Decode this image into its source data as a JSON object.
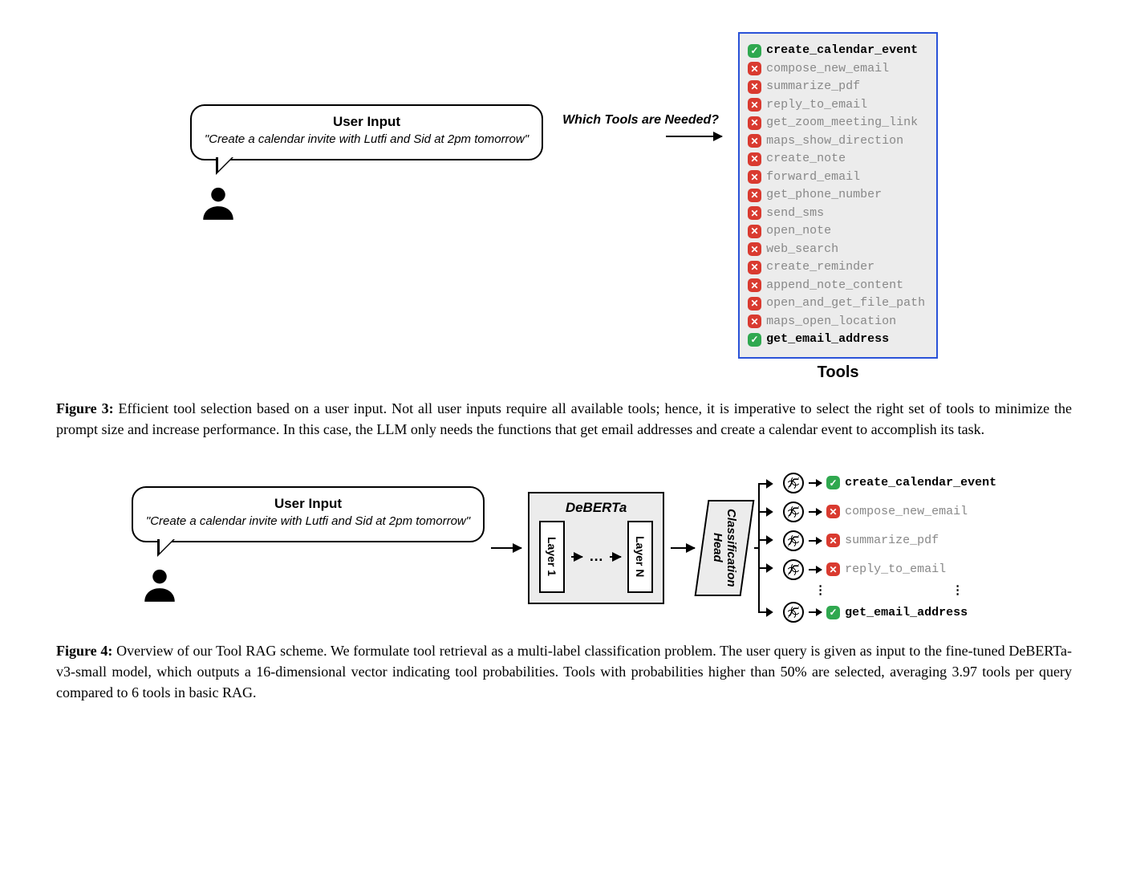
{
  "fig3": {
    "user_input_title": "User Input",
    "user_quote": "\"Create a calendar invite with Lutfi and Sid at 2pm tomorrow\"",
    "question": "Which Tools are Needed?",
    "tools_label": "Tools",
    "tools": [
      {
        "name": "create_calendar_event",
        "selected": true
      },
      {
        "name": "compose_new_email",
        "selected": false
      },
      {
        "name": "summarize_pdf",
        "selected": false
      },
      {
        "name": "reply_to_email",
        "selected": false
      },
      {
        "name": "get_zoom_meeting_link",
        "selected": false
      },
      {
        "name": "maps_show_direction",
        "selected": false
      },
      {
        "name": "create_note",
        "selected": false
      },
      {
        "name": "forward_email",
        "selected": false
      },
      {
        "name": "get_phone_number",
        "selected": false
      },
      {
        "name": "send_sms",
        "selected": false
      },
      {
        "name": "open_note",
        "selected": false
      },
      {
        "name": "web_search",
        "selected": false
      },
      {
        "name": "create_reminder",
        "selected": false
      },
      {
        "name": "append_note_content",
        "selected": false
      },
      {
        "name": "open_and_get_file_path",
        "selected": false
      },
      {
        "name": "maps_open_location",
        "selected": false
      },
      {
        "name": "get_email_address",
        "selected": true
      }
    ],
    "caption_label": "Figure 3:",
    "caption_text": "Efficient tool selection based on a user input. Not all user inputs require all available tools; hence, it is imperative to select the right set of tools to minimize the prompt size and increase performance. In this case, the LLM only needs the functions that get email addresses and create a calendar event to accomplish its task."
  },
  "fig4": {
    "user_input_title": "User Input",
    "user_quote": "\"Create a calendar invite with Lutfi and Sid at 2pm tomorrow\"",
    "model_title": "DeBERTa",
    "layer_first": "Layer 1",
    "layer_dots": "…",
    "layer_last": "Layer N",
    "classification_head": "Classification Head",
    "outputs": [
      {
        "name": "create_calendar_event",
        "selected": true
      },
      {
        "name": "compose_new_email",
        "selected": false
      },
      {
        "name": "summarize_pdf",
        "selected": false
      },
      {
        "name": "reply_to_email",
        "selected": false
      }
    ],
    "output_last": {
      "name": "get_email_address",
      "selected": true
    },
    "caption_label": "Figure 4:",
    "caption_text": "Overview of our Tool RAG scheme. We formulate tool retrieval as a multi-label classification problem. The user query is given as input to the fine-tuned DeBERTa-v3-small model, which outputs a 16-dimensional vector indicating tool probabilities. Tools with probabilities higher than 50% are selected, averaging 3.97 tools per query compared to 6 tools in basic RAG."
  }
}
